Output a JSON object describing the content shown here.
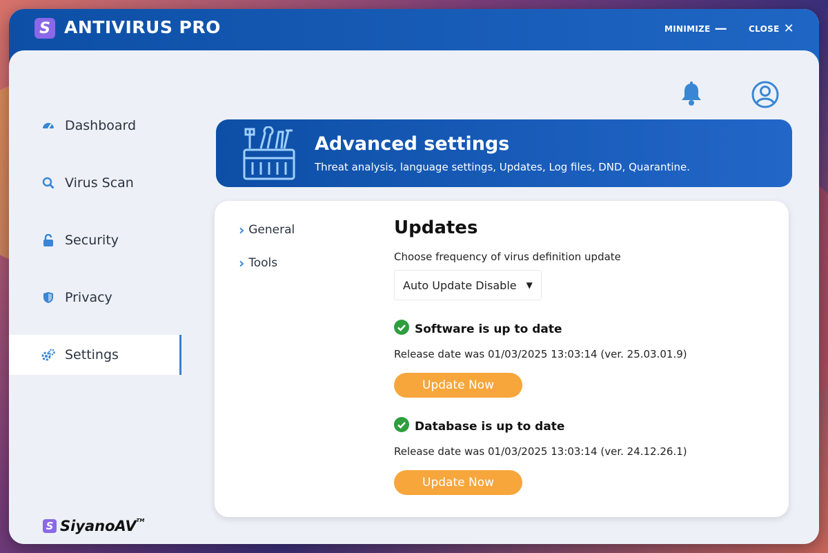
{
  "app": {
    "logo_letter": "S",
    "title": "ANTIVIRUS PRO"
  },
  "window_controls": {
    "minimize_label": "MINIMIZE",
    "close_label": "CLOSE"
  },
  "sidebar": {
    "items": [
      {
        "label": "Dashboard",
        "icon": "gauge-icon",
        "active": false
      },
      {
        "label": "Virus Scan",
        "icon": "search-icon",
        "active": false
      },
      {
        "label": "Security",
        "icon": "lock-icon",
        "active": false
      },
      {
        "label": "Privacy",
        "icon": "shield-icon",
        "active": false
      },
      {
        "label": "Settings",
        "icon": "gears-icon",
        "active": true
      }
    ],
    "brand": {
      "letter": "S",
      "name": "SiyanoAV",
      "tm": "TM"
    }
  },
  "banner": {
    "icon": "toolbox-icon",
    "title": "Advanced settings",
    "subtitle": "Threat analysis, language settings, Updates, Log files, DND, Quarantine."
  },
  "subnav": {
    "items": [
      {
        "label": "General"
      },
      {
        "label": "Tools"
      }
    ]
  },
  "updates": {
    "heading": "Updates",
    "frequency_label": "Choose frequency of virus definition update",
    "frequency_value": "Auto Update Disable",
    "software": {
      "status": "Software is up to date",
      "release": "Release date was 01/03/2025 13:03:14 (ver. 25.03.01.9)",
      "button": "Update Now"
    },
    "database": {
      "status": "Database is up to date",
      "release": "Release date was 01/03/2025 13:03:14 (ver. 24.12.26.1)",
      "button": "Update Now"
    }
  },
  "colors": {
    "primary": "#0d4fa6",
    "accent": "#f7a63c",
    "check": "#2e9e3e",
    "icon_blue": "#3a86d4"
  }
}
